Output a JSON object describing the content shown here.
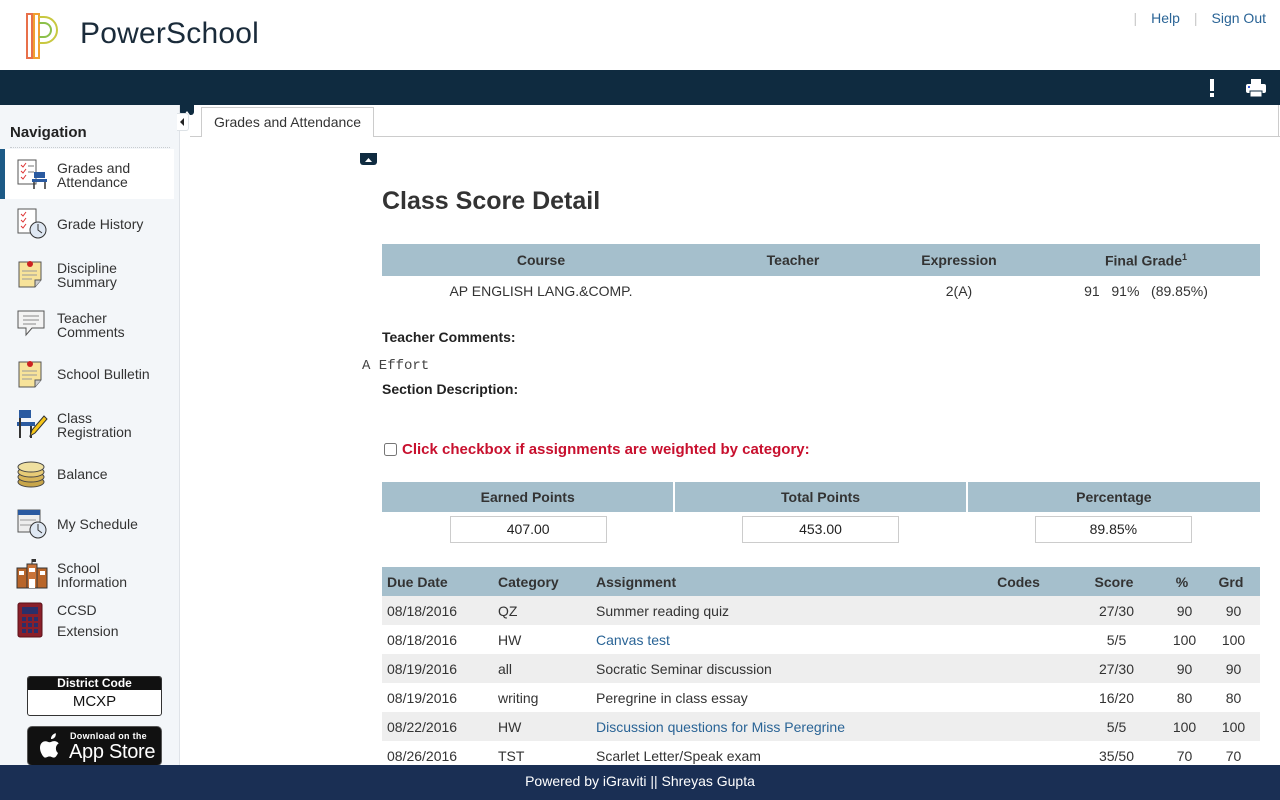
{
  "header": {
    "brand": "PowerSchool",
    "links": {
      "help": "Help",
      "sign_out": "Sign Out"
    }
  },
  "toolbar": {
    "icons": [
      "alert-icon",
      "print-icon"
    ]
  },
  "sidebar": {
    "title": "Navigation",
    "items": [
      {
        "label1": "Grades and",
        "label2": "Attendance",
        "icon": "grades-attendance-icon",
        "active": true
      },
      {
        "label1": "Grade History",
        "label2": "",
        "icon": "grade-history-icon"
      },
      {
        "label1": "Discipline",
        "label2": "Summary",
        "icon": "discipline-icon"
      },
      {
        "label1": "Teacher",
        "label2": "Comments",
        "icon": "teacher-comments-icon"
      },
      {
        "label1": "School Bulletin",
        "label2": "",
        "icon": "bulletin-icon"
      },
      {
        "label1": "Class",
        "label2": "Registration",
        "icon": "class-registration-icon"
      },
      {
        "label1": "Balance",
        "label2": "",
        "icon": "balance-icon"
      },
      {
        "label1": "My Schedule",
        "label2": "",
        "icon": "schedule-icon"
      },
      {
        "label1": "School",
        "label2": "Information",
        "icon": "school-info-icon"
      },
      {
        "label1": "CCSD",
        "label2": "Extension",
        "icon": "ccsd-extension-icon"
      }
    ],
    "district_code": {
      "header": "District Code",
      "value": "MCXP"
    },
    "app_store": {
      "small": "Download on the",
      "big": "App Store"
    }
  },
  "tabs": [
    {
      "label": "Grades and Attendance",
      "active": true
    }
  ],
  "page": {
    "title": "Class Score Detail",
    "course_table": {
      "headers": {
        "course": "Course",
        "teacher": "Teacher",
        "expression": "Expression",
        "final_grade": "Final Grade",
        "final_grade_sup": "1"
      },
      "row": {
        "course": "AP ENGLISH LANG.&COMP.",
        "teacher": "",
        "expression": "2(A)",
        "final_grade": "91   91%   (89.85%)"
      }
    },
    "teacher_comments_label": "Teacher Comments:",
    "teacher_comment": "A Effort",
    "section_description_label": "Section Description:",
    "weighted_checkbox_label": "Click checkbox if assignments are weighted by category:",
    "weighted_checked": false,
    "points_table": {
      "headers": {
        "earned": "Earned Points",
        "total": "Total Points",
        "percentage": "Percentage"
      },
      "values": {
        "earned": "407.00",
        "total": "453.00",
        "percentage": "89.85%"
      }
    },
    "assignments": {
      "headers": {
        "due_date": "Due Date",
        "category": "Category",
        "assignment": "Assignment",
        "codes": "Codes",
        "score": "Score",
        "pct": "%",
        "grd": "Grd"
      },
      "rows": [
        {
          "due_date": "08/18/2016",
          "category": "QZ",
          "assignment": "Summer reading quiz",
          "link": false,
          "codes": "",
          "score": "27/30",
          "pct": "90",
          "grd": "90"
        },
        {
          "due_date": "08/18/2016",
          "category": "HW",
          "assignment": "Canvas test",
          "link": true,
          "codes": "",
          "score": "5/5",
          "pct": "100",
          "grd": "100"
        },
        {
          "due_date": "08/19/2016",
          "category": "all",
          "assignment": "Socratic Seminar discussion",
          "link": false,
          "codes": "",
          "score": "27/30",
          "pct": "90",
          "grd": "90"
        },
        {
          "due_date": "08/19/2016",
          "category": "writing",
          "assignment": "Peregrine in class essay",
          "link": false,
          "codes": "",
          "score": "16/20",
          "pct": "80",
          "grd": "80"
        },
        {
          "due_date": "08/22/2016",
          "category": "HW",
          "assignment": "Discussion questions for Miss Peregrine",
          "link": true,
          "codes": "",
          "score": "5/5",
          "pct": "100",
          "grd": "100"
        },
        {
          "due_date": "08/26/2016",
          "category": "TST",
          "assignment": "Scarlet Letter/Speak exam",
          "link": false,
          "codes": "",
          "score": "35/50",
          "pct": "70",
          "grd": "70"
        }
      ]
    }
  },
  "footer": {
    "text": "Powered by iGraviti || Shreyas Gupta"
  },
  "colors": {
    "navbar": "#0f2b40",
    "table_header": "#a5bfcc",
    "link": "#2a6496",
    "warning_text": "#c8102e",
    "footer": "#1a2f54"
  }
}
